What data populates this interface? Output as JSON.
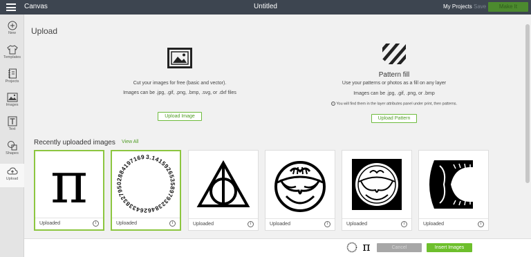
{
  "topbar": {
    "app_title": "Canvas",
    "doc_title": "Untitled",
    "my_projects": "My Projects",
    "save": "Save",
    "make_it": "Make It"
  },
  "sidebar": {
    "items": [
      {
        "label": "New",
        "icon": "plus-circle-icon"
      },
      {
        "label": "Templates",
        "icon": "shirt-icon"
      },
      {
        "label": "Projects",
        "icon": "notebook-icon"
      },
      {
        "label": "Images",
        "icon": "image-icon"
      },
      {
        "label": "Text",
        "icon": "text-icon"
      },
      {
        "label": "Shapes",
        "icon": "shapes-icon"
      },
      {
        "label": "Upload",
        "icon": "cloud-upload-icon"
      }
    ],
    "active_item": "Upload"
  },
  "main": {
    "title": "Upload",
    "upload_image": {
      "icon": "image-frame-icon",
      "desc1": "Cut your images for free (basic and vector).",
      "desc2": "Images can be .jpg, .gif, .png, .bmp, .svg, or .dxf files",
      "button": "Upload Image"
    },
    "pattern": {
      "icon": "striped-square-icon",
      "title": "Pattern fill",
      "desc1": "Use your patterns or photos as a fill on any layer",
      "desc2": "Images can be .jpg, .gif, .png, or .bmp",
      "note": "You will find them in the layer attributes panel under print, then patterns.",
      "button": "Upload Pattern"
    },
    "recent": {
      "title": "Recently uploaded images",
      "view_all": "View All",
      "tiles": [
        {
          "label": "Uploaded",
          "image": "pi-symbol",
          "selected": true
        },
        {
          "label": "Uploaded",
          "image": "pi-digits-circle",
          "selected": true
        },
        {
          "label": "Uploaded",
          "image": "deathly-hallows",
          "selected": false
        },
        {
          "label": "Uploaded",
          "image": "ornate-circle",
          "selected": false
        },
        {
          "label": "Uploaded",
          "image": "ornate-square",
          "selected": false
        },
        {
          "label": "Uploaded",
          "image": "ornate-c-shape",
          "selected": false
        }
      ]
    }
  },
  "pi_digits_text": "3.14159265358979323846264338327950288419716939937",
  "pi_glyph": "π",
  "info_glyph": "i",
  "bottombar": {
    "cancel": "Cancel",
    "insert": "Insert Images"
  },
  "colors": {
    "topbar": "#3d4550",
    "accent_green": "#6dbf2c",
    "selected_border": "#8cc63f"
  }
}
